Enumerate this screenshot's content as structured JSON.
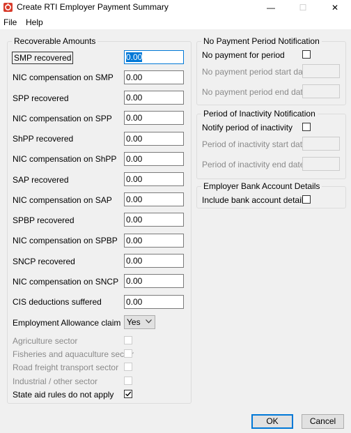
{
  "window": {
    "title": "Create RTI Employer Payment Summary",
    "controls": {
      "minimize": "—",
      "maximize": "☐",
      "close": "✕"
    }
  },
  "menu": [
    "File",
    "Help"
  ],
  "recoverable": {
    "title": "Recoverable Amounts",
    "fields": [
      {
        "label": "SMP recovered",
        "value": "0.00"
      },
      {
        "label": "NIC compensation on SMP",
        "value": "0.00"
      },
      {
        "label": "SPP recovered",
        "value": "0.00"
      },
      {
        "label": "NIC compensation on SPP",
        "value": "0.00"
      },
      {
        "label": "ShPP recovered",
        "value": "0.00"
      },
      {
        "label": "NIC compensation on ShPP",
        "value": "0.00"
      },
      {
        "label": "SAP recovered",
        "value": "0.00"
      },
      {
        "label": "NIC compensation on SAP",
        "value": "0.00"
      },
      {
        "label": "SPBP recovered",
        "value": "0.00"
      },
      {
        "label": "NIC compensation on SPBP",
        "value": "0.00"
      },
      {
        "label": "SNCP recovered",
        "value": "0.00"
      },
      {
        "label": "NIC compensation on SNCP",
        "value": "0.00"
      },
      {
        "label": "CIS deductions suffered",
        "value": "0.00"
      }
    ],
    "allowance": {
      "label": "Employment Allowance claim",
      "value": "Yes"
    },
    "sectors": [
      {
        "label": "Agriculture sector",
        "checked": false,
        "enabled": false
      },
      {
        "label": "Fisheries and aquaculture sector",
        "checked": false,
        "enabled": false
      },
      {
        "label": "Road freight transport sector",
        "checked": false,
        "enabled": false
      },
      {
        "label": "Industrial / other sector",
        "checked": false,
        "enabled": false
      },
      {
        "label": "State aid rules do not apply",
        "checked": true,
        "enabled": true
      }
    ]
  },
  "no_payment": {
    "title": "No Payment Period Notification",
    "checkbox_label": "No payment for period",
    "checked": false,
    "start_label": "No payment period start date",
    "end_label": "No payment period end date"
  },
  "inactivity": {
    "title": "Period of Inactivity Notification",
    "checkbox_label": "Notify period of inactivity",
    "checked": false,
    "start_label": "Period of inactivity start date",
    "end_label": "Period of inactivity end date"
  },
  "bank": {
    "title": "Employer Bank Account Details",
    "checkbox_label": "Include bank account details",
    "checked": false
  },
  "buttons": {
    "ok": "OK",
    "cancel": "Cancel"
  }
}
